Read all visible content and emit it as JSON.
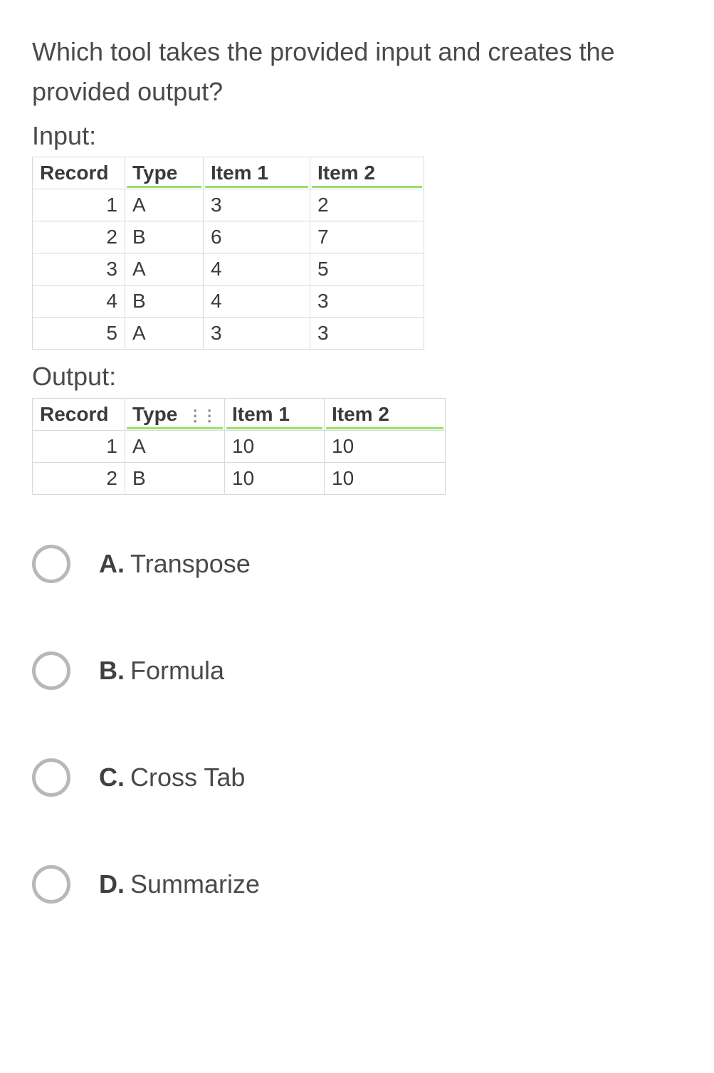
{
  "question": "Which tool takes the provided input and creates the provided output?",
  "labels": {
    "input": "Input:",
    "output": "Output:"
  },
  "input_table": {
    "headers": [
      "Record",
      "Type",
      "Item 1",
      "Item 2"
    ],
    "rows": [
      {
        "record": "1",
        "type": "A",
        "item1": "3",
        "item2": "2"
      },
      {
        "record": "2",
        "type": "B",
        "item1": "6",
        "item2": "7"
      },
      {
        "record": "3",
        "type": "A",
        "item1": "4",
        "item2": "5"
      },
      {
        "record": "4",
        "type": "B",
        "item1": "4",
        "item2": "3"
      },
      {
        "record": "5",
        "type": "A",
        "item1": "3",
        "item2": "3"
      }
    ]
  },
  "output_table": {
    "headers": [
      "Record",
      "Type",
      "Item 1",
      "Item 2"
    ],
    "grip_after_type": true,
    "rows": [
      {
        "record": "1",
        "type": "A",
        "item1": "10",
        "item2": "10"
      },
      {
        "record": "2",
        "type": "B",
        "item1": "10",
        "item2": "10"
      }
    ]
  },
  "options": [
    {
      "letter": "A.",
      "text": "Transpose"
    },
    {
      "letter": "B.",
      "text": "Formula"
    },
    {
      "letter": "C.",
      "text": "Cross Tab"
    },
    {
      "letter": "D.",
      "text": "Summarize"
    }
  ]
}
